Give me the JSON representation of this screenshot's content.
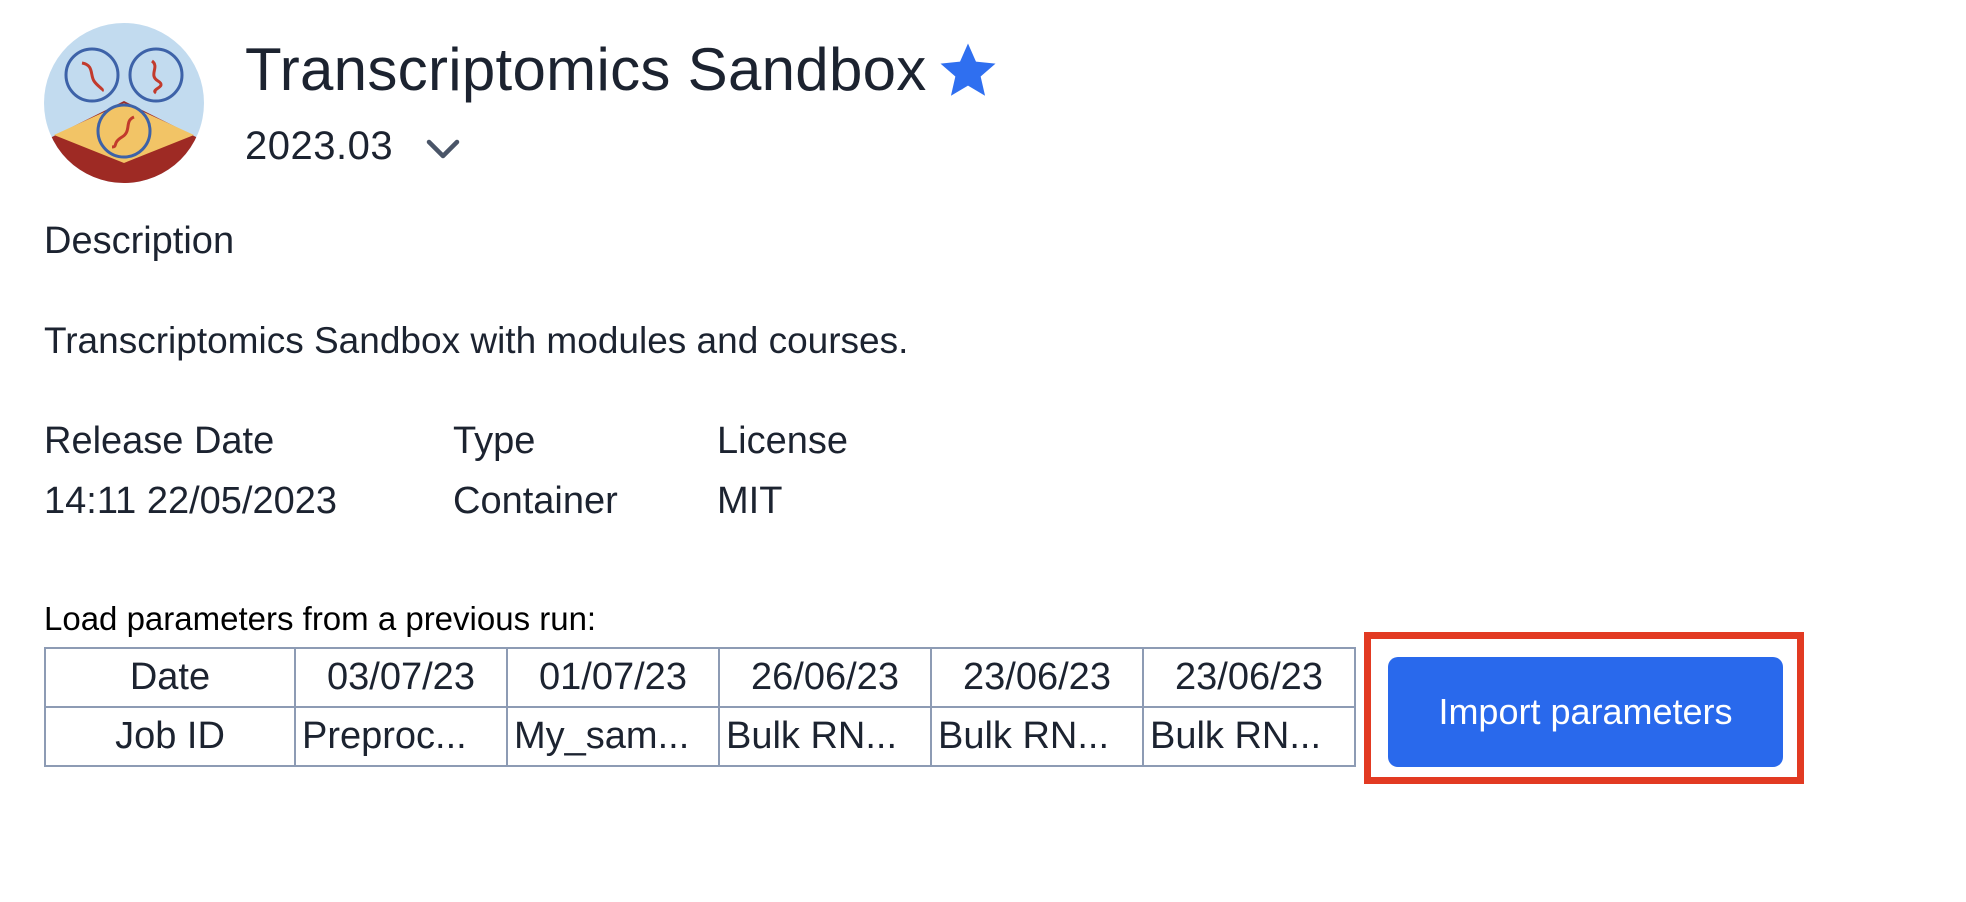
{
  "app": {
    "title": "Transcriptomics Sandbox",
    "version": "2023.03",
    "logo_icon": "dna-circles-logo-icon",
    "favorite_icon": "star-icon",
    "accent_color": "#2969ec"
  },
  "description": {
    "heading": "Description",
    "text": "Transcriptomics Sandbox with modules and courses."
  },
  "metadata": {
    "release_date_label": "Release Date",
    "release_date_value": "14:11 22/05/2023",
    "type_label": "Type",
    "type_value": "Container",
    "license_label": "License",
    "license_value": "MIT"
  },
  "previous_runs": {
    "label": "Load parameters from a previous run:",
    "row_headers": {
      "date": "Date",
      "job_id": "Job ID"
    },
    "runs": [
      {
        "date": "03/07/23",
        "job_id": "Preproc..."
      },
      {
        "date": "01/07/23",
        "job_id": "My_sam..."
      },
      {
        "date": "26/06/23",
        "job_id": "Bulk RN..."
      },
      {
        "date": "23/06/23",
        "job_id": "Bulk RN..."
      },
      {
        "date": "23/06/23",
        "job_id": "Bulk RN..."
      }
    ]
  },
  "actions": {
    "import_label": "Import parameters",
    "highlight_color": "#e23a22"
  }
}
